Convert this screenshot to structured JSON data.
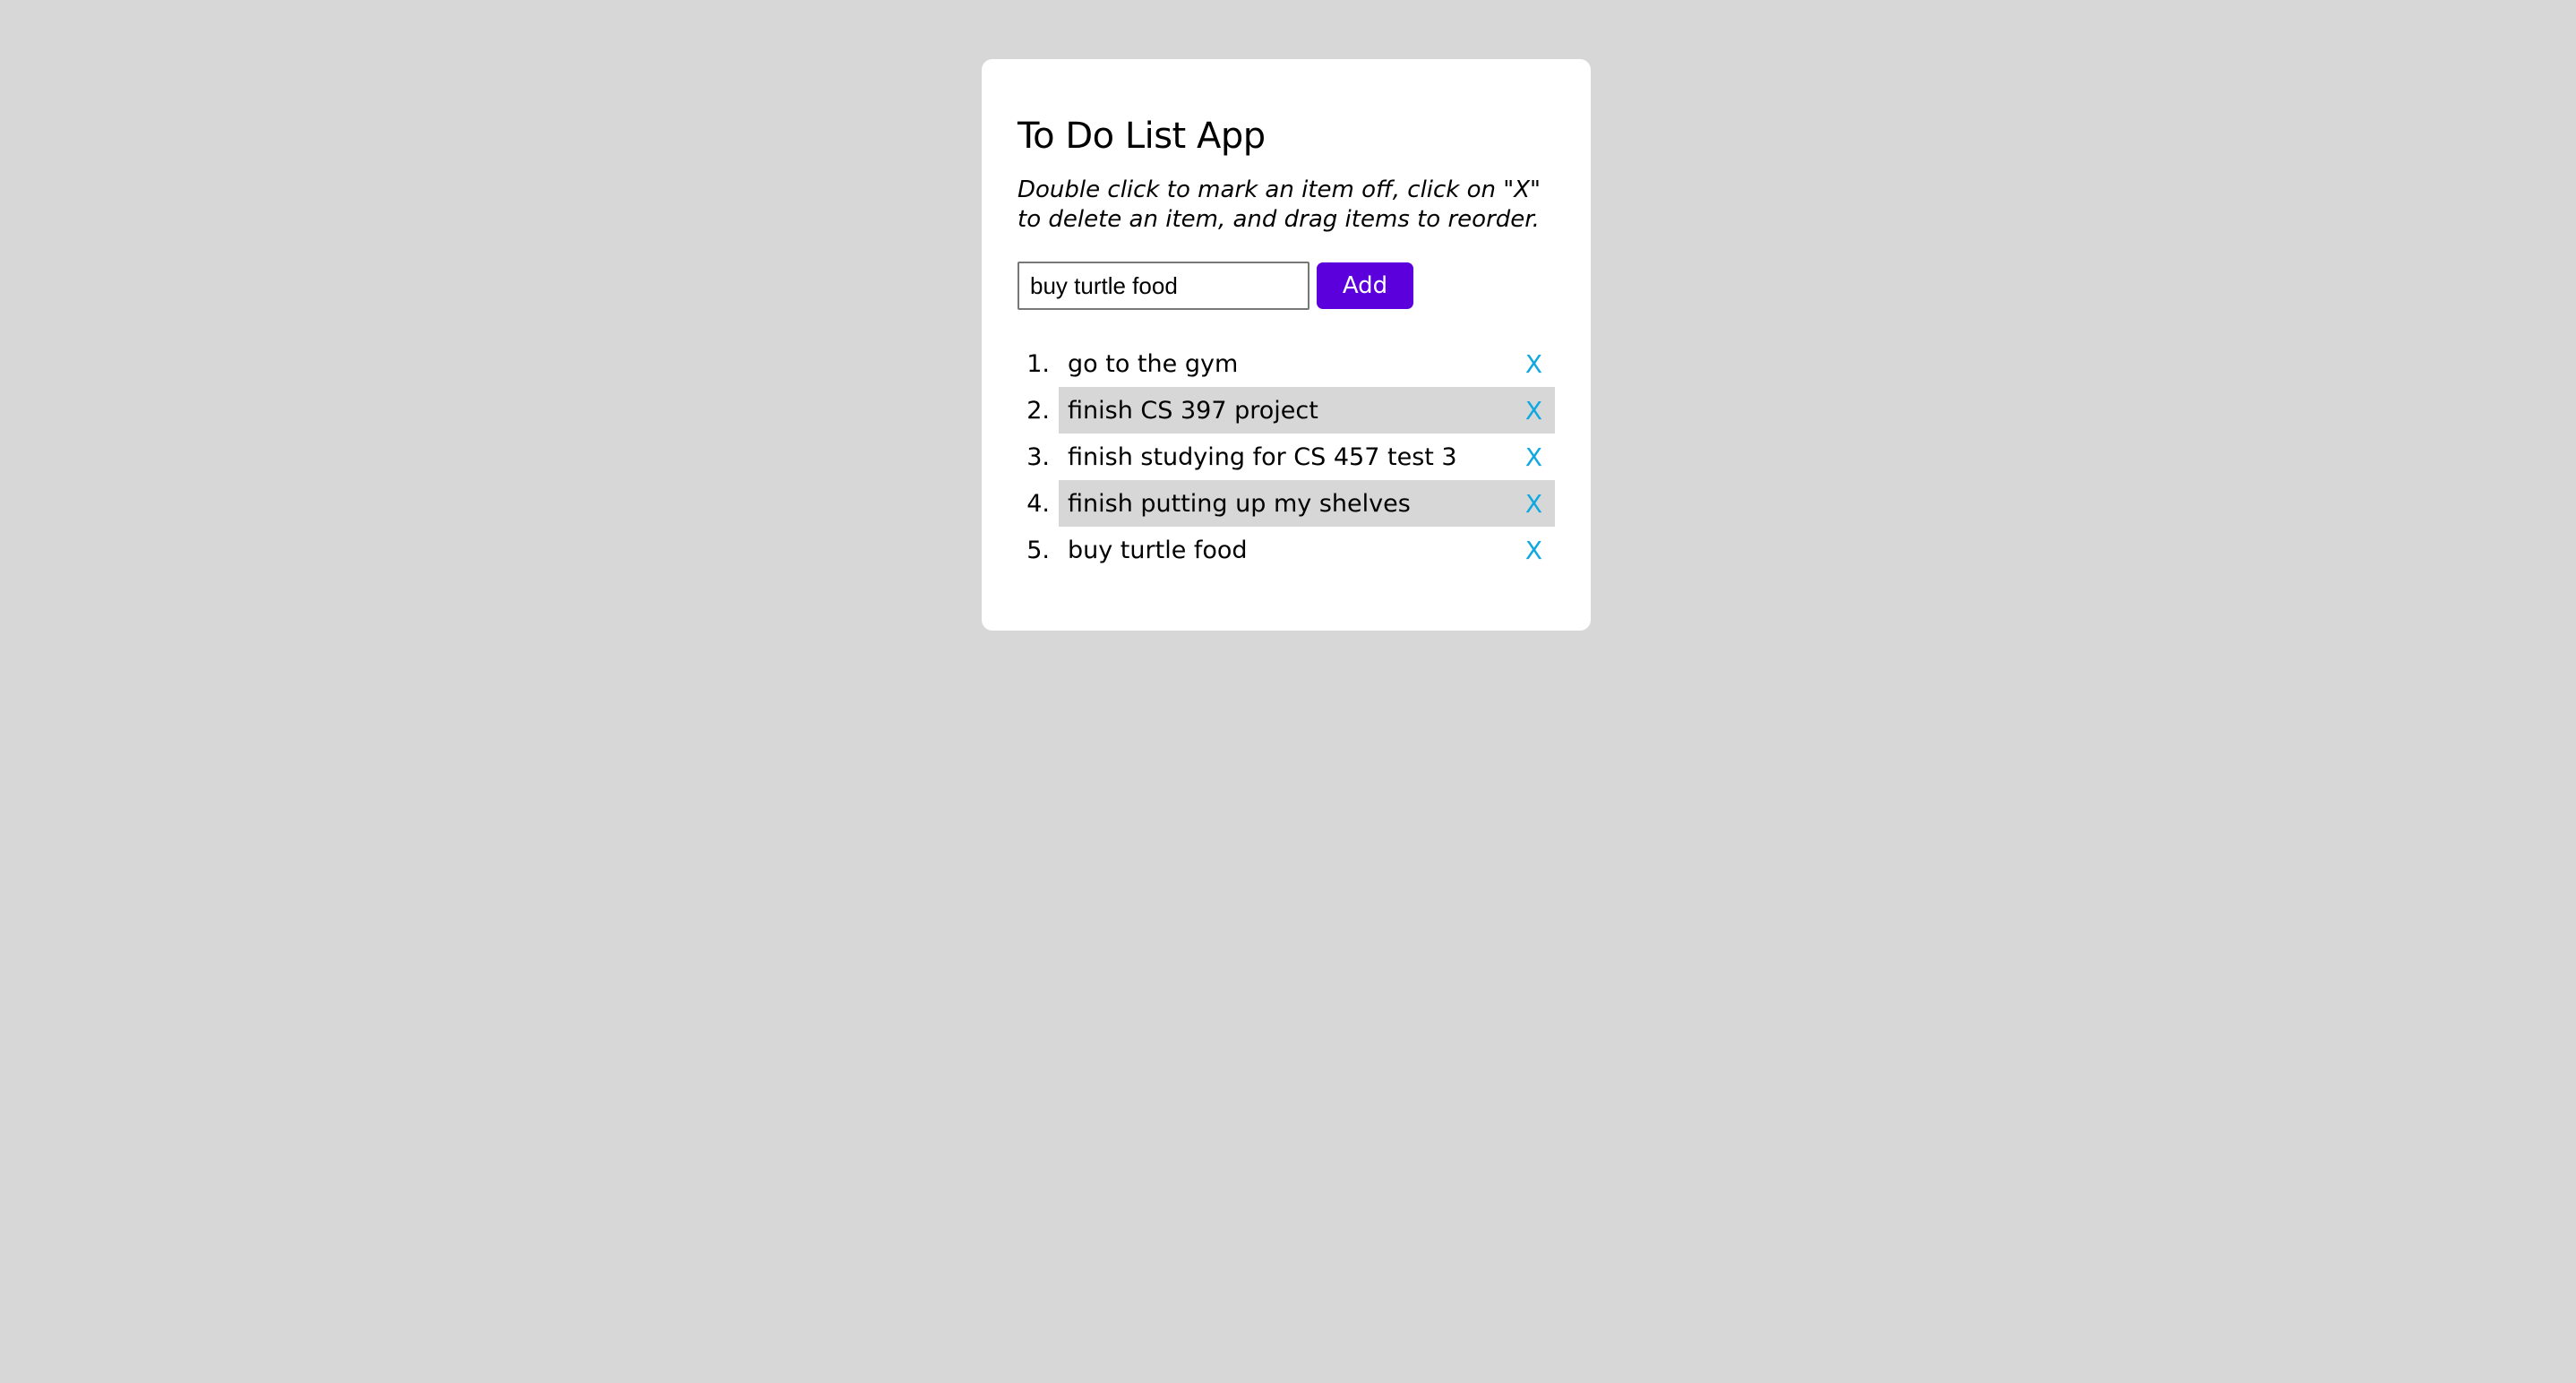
{
  "app": {
    "title": "To Do List App",
    "instructions": "Double click to mark an item off, click on \"X\" to delete an item, and drag items to reorder."
  },
  "form": {
    "input_value": "buy turtle food",
    "add_label": "Add"
  },
  "todos": [
    {
      "number": "1.",
      "text": "go to the gym",
      "delete_label": "X"
    },
    {
      "number": "2.",
      "text": "finish CS 397 project",
      "delete_label": "X"
    },
    {
      "number": "3.",
      "text": "finish studying for CS 457 test 3",
      "delete_label": "X"
    },
    {
      "number": "4.",
      "text": "finish putting up my shelves",
      "delete_label": "X"
    },
    {
      "number": "5.",
      "text": "buy turtle food",
      "delete_label": "X"
    }
  ],
  "colors": {
    "background": "#d7d7d7",
    "card": "#ffffff",
    "accent_button": "#5b00dc",
    "delete_x": "#0fa8e0",
    "striped_row": "#d7d7d7"
  }
}
